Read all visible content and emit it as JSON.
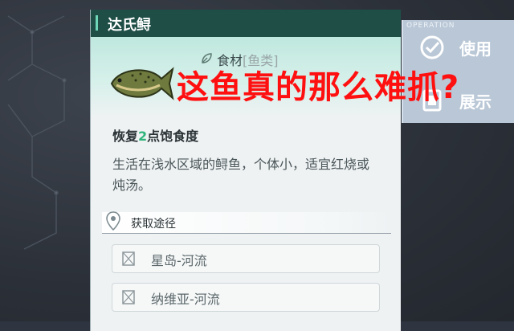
{
  "item": {
    "name": "达氏鲟",
    "category": "食材",
    "subcategory": "[鱼类]",
    "effect_prefix": "恢复",
    "effect_value": "2",
    "effect_suffix": "点饱食度",
    "description": "生活在浅水区域的鲟鱼，个体小，适宜红烧或炖汤。"
  },
  "source": {
    "title": "获取途径",
    "locations": [
      "星岛-河流",
      "纳维亚-河流"
    ]
  },
  "operations": {
    "title": "OPERATION",
    "use_label": "使用",
    "show_label": "展示"
  },
  "overlay_text": "这鱼真的那么难抓?",
  "colors": {
    "title_bar": "#1f4e47",
    "accent": "#6fd6b8",
    "effect_number": "#2fb37b",
    "overlay": "#ff1010"
  }
}
